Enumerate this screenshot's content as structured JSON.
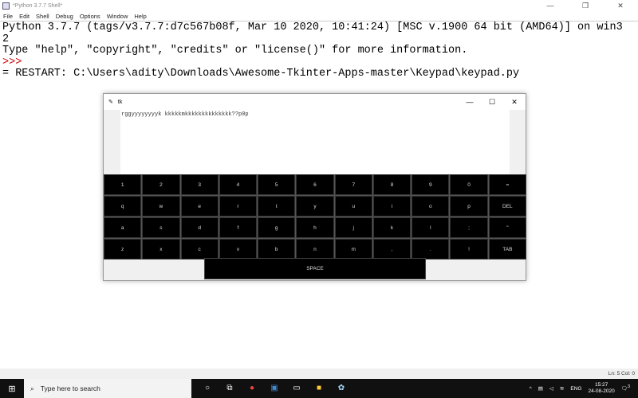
{
  "idle": {
    "title": "*Python 3.7.7 Shell*",
    "menu": [
      "File",
      "Edit",
      "Shell",
      "Debug",
      "Options",
      "Window",
      "Help"
    ],
    "lines": [
      "Python 3.7.7 (tags/v3.7.7:d7c567b08f, Mar 10 2020, 10:41:24) [MSC v.1900 64 bit (AMD64)] on win3",
      "2",
      "Type \"help\", \"copyright\", \"credits\" or \"license()\" for more information."
    ],
    "prompt": ">>>",
    "restart": "= RESTART: C:\\Users\\adity\\Downloads\\Awesome-Tkinter-Apps-master\\Keypad\\keypad.py",
    "status": "Ln: 5  Col: 0"
  },
  "tk": {
    "title": "tk",
    "text": "rggyyyyyyyyk kkkkkmkkkkkkkkkkkkkk??p0p",
    "rows": [
      [
        "1",
        "2",
        "3",
        "4",
        "5",
        "6",
        "7",
        "8",
        "9",
        "0",
        "="
      ],
      [
        "q",
        "w",
        "e",
        "r",
        "t",
        "y",
        "u",
        "i",
        "o",
        "p",
        "DEL"
      ],
      [
        "a",
        "s",
        "d",
        "f",
        "g",
        "h",
        "j",
        "k",
        "l",
        ";",
        "\""
      ],
      [
        "z",
        "x",
        "c",
        "v",
        "b",
        "n",
        "m",
        ",",
        ".",
        "!",
        "TAB"
      ]
    ],
    "space": "SPACE"
  },
  "taskbar": {
    "search_placeholder": "Type here to search",
    "lang": "ENG",
    "time": "15:27",
    "date": "24-08-2020",
    "notifications": "3"
  }
}
